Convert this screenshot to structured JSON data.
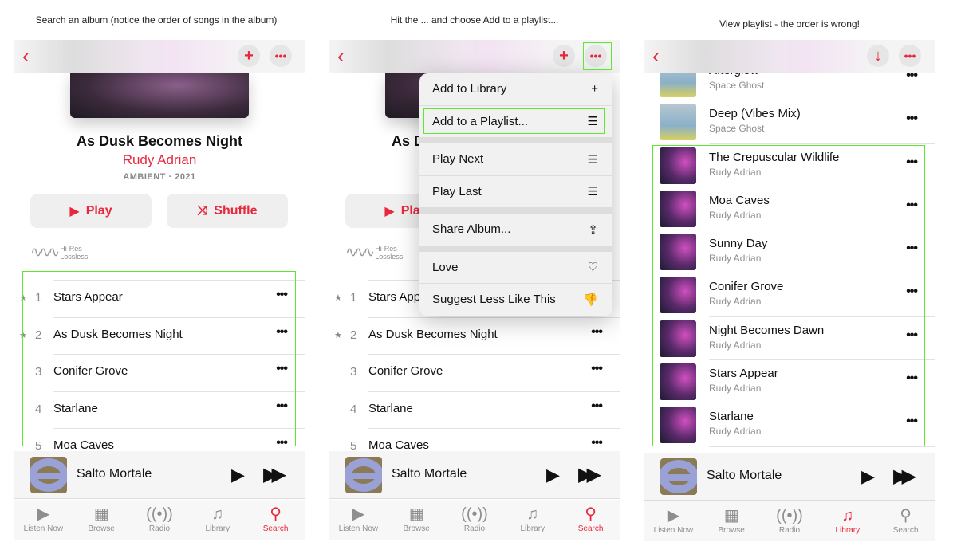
{
  "captions": [
    "Search an album (notice the order of songs in the album)",
    "Hit the ... and choose Add to a playlist...",
    "View playlist - the order is wrong!"
  ],
  "accent": "#e8273c",
  "highlight": "#5ee82f",
  "album": {
    "title": "As Dusk Becomes Night",
    "artist": "Rudy Adrian",
    "genre": "AMBIENT · 2021",
    "play": "Play",
    "shuffle": "Shuffle",
    "hires_1": "Hi-Res",
    "hires_2": "Lossless",
    "tracks": [
      {
        "num": "1",
        "name": "Stars Appear",
        "starred": true
      },
      {
        "num": "2",
        "name": "As Dusk Becomes Night",
        "starred": true
      },
      {
        "num": "3",
        "name": "Conifer Grove",
        "starred": false
      },
      {
        "num": "4",
        "name": "Starlane",
        "starred": false
      },
      {
        "num": "5",
        "name": "Moa Caves",
        "starred": false
      }
    ]
  },
  "menu": [
    {
      "label": "Add to Library",
      "icon": "plus-icon",
      "glyph": "+"
    },
    {
      "label": "Add to a Playlist...",
      "icon": "add-to-playlist-icon",
      "glyph": "☰"
    },
    {
      "sep": true
    },
    {
      "label": "Play Next",
      "icon": "play-next-icon",
      "glyph": "☰"
    },
    {
      "label": "Play Last",
      "icon": "play-last-icon",
      "glyph": "☰"
    },
    {
      "sep": true
    },
    {
      "label": "Share Album...",
      "icon": "share-icon",
      "glyph": "⇪"
    },
    {
      "sep": true
    },
    {
      "label": "Love",
      "icon": "heart-icon",
      "glyph": "♡"
    },
    {
      "label": "Suggest Less Like This",
      "icon": "thumbs-down-icon",
      "glyph": "👎"
    }
  ],
  "playlist": [
    {
      "name": "Afterglow",
      "artist": "Space Ghost",
      "art": "space-ghost"
    },
    {
      "name": "Deep (Vibes Mix)",
      "artist": "Space Ghost",
      "art": "space-ghost"
    },
    {
      "name": "The Crepuscular Wildlife",
      "artist": "Rudy Adrian",
      "art": "dusk"
    },
    {
      "name": "Moa Caves",
      "artist": "Rudy Adrian",
      "art": "dusk"
    },
    {
      "name": "Sunny Day",
      "artist": "Rudy Adrian",
      "art": "dusk"
    },
    {
      "name": "Conifer Grove",
      "artist": "Rudy Adrian",
      "art": "dusk"
    },
    {
      "name": "Night Becomes Dawn",
      "artist": "Rudy Adrian",
      "art": "dusk"
    },
    {
      "name": "Stars Appear",
      "artist": "Rudy Adrian",
      "art": "dusk"
    },
    {
      "name": "Starlane",
      "artist": "Rudy Adrian",
      "art": "dusk"
    }
  ],
  "now_playing": "Salto Mortale",
  "tabs": [
    {
      "label": "Listen Now",
      "icon": "listen-now-icon",
      "glyph": "▶"
    },
    {
      "label": "Browse",
      "icon": "browse-icon",
      "glyph": "▦"
    },
    {
      "label": "Radio",
      "icon": "radio-icon",
      "glyph": "((•))"
    },
    {
      "label": "Library",
      "icon": "library-icon",
      "glyph": "♫"
    },
    {
      "label": "Search",
      "icon": "search-icon",
      "glyph": "⚲"
    }
  ],
  "active_tab": [
    "Search",
    "Search",
    "Library"
  ]
}
